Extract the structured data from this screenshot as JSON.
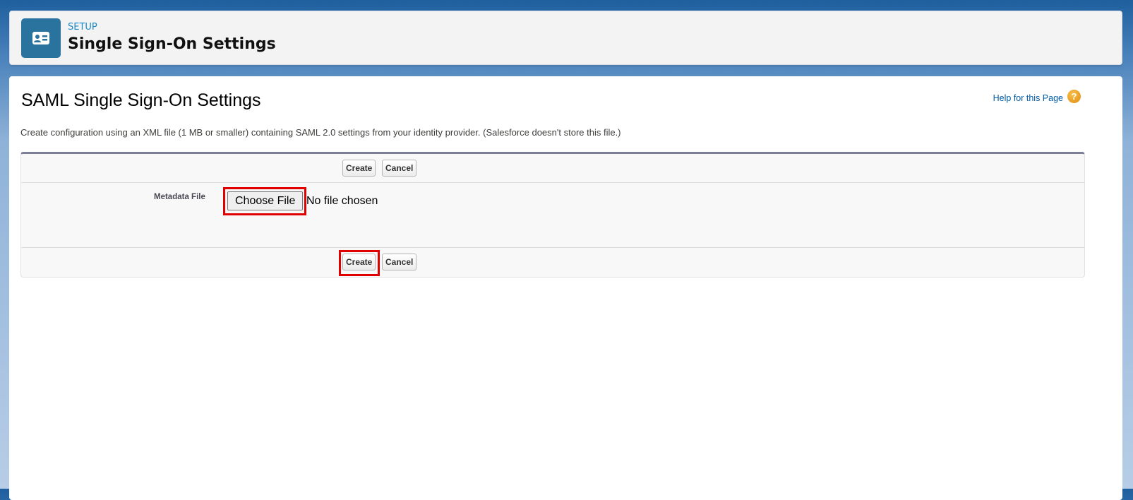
{
  "header": {
    "eyebrow": "SETUP",
    "title": "Single Sign-On Settings",
    "icon": "contact-card-icon"
  },
  "page": {
    "title": "SAML Single Sign-On Settings",
    "help_link": "Help for this Page",
    "help_icon": "?",
    "description": "Create configuration using an XML file (1 MB or smaller) containing SAML 2.0 settings from your identity provider. (Salesforce doesn't store this file.)"
  },
  "form": {
    "create_label": "Create",
    "cancel_label": "Cancel",
    "metadata_label": "Metadata File",
    "choose_file_label": "Choose File",
    "file_status": "No file chosen"
  },
  "colors": {
    "highlight": "#e00000",
    "brand": "#2a739f"
  }
}
